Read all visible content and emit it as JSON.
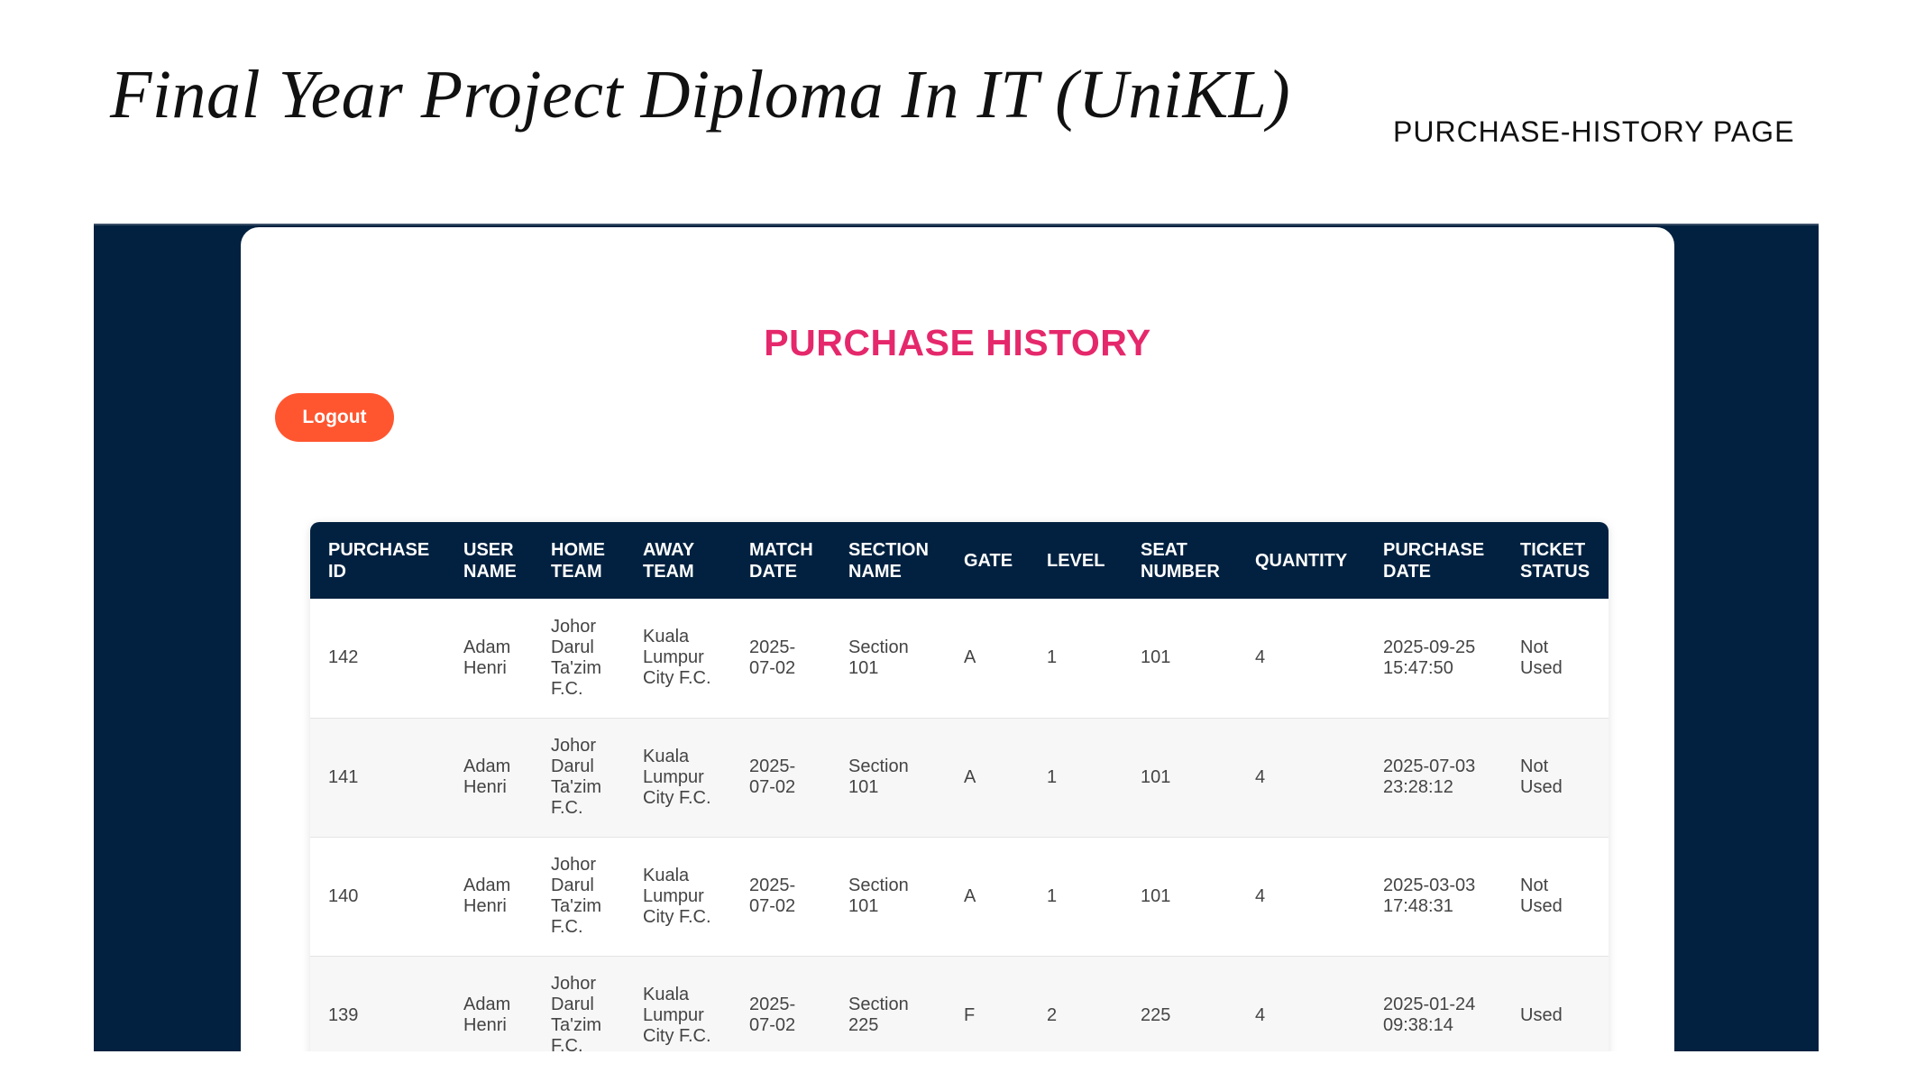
{
  "slide": {
    "title": "Final Year Project Diploma In IT (UniKL)",
    "subtitle": "PURCHASE-HISTORY PAGE"
  },
  "app": {
    "heading": "PURCHASE HISTORY",
    "logout_label": "Logout",
    "colors": {
      "frame_background": "#022140",
      "heading": "#e5286b",
      "logout_button": "#ff5630",
      "table_header": "#022140"
    }
  },
  "table": {
    "columns": [
      {
        "line1": "PURCHASE",
        "line2": "ID"
      },
      {
        "line1": "USER",
        "line2": "NAME"
      },
      {
        "line1": "HOME",
        "line2": "TEAM"
      },
      {
        "line1": "AWAY",
        "line2": "TEAM"
      },
      {
        "line1": "MATCH",
        "line2": "DATE"
      },
      {
        "line1": "SECTION",
        "line2": "NAME"
      },
      {
        "line1": "GATE",
        "line2": ""
      },
      {
        "line1": "LEVEL",
        "line2": ""
      },
      {
        "line1": "SEAT",
        "line2": "NUMBER"
      },
      {
        "line1": "QUANTITY",
        "line2": ""
      },
      {
        "line1": "PURCHASE",
        "line2": "DATE"
      },
      {
        "line1": "TICKET",
        "line2": "STATUS"
      }
    ],
    "rows": [
      {
        "purchase_id": "142",
        "user_name": [
          "Adam",
          "Henri"
        ],
        "home_team": [
          "Johor",
          "Darul",
          "Ta'zim",
          "F.C."
        ],
        "away_team": [
          "Kuala",
          "Lumpur",
          "City F.C."
        ],
        "match_date": [
          "2025-",
          "07-02"
        ],
        "section_name": [
          "Section",
          "101"
        ],
        "gate": "A",
        "level": "1",
        "seat_number": "101",
        "quantity": "4",
        "purchase_date": [
          "2025-09-25",
          "15:47:50"
        ],
        "ticket_status": [
          "Not",
          "Used"
        ]
      },
      {
        "purchase_id": "141",
        "user_name": [
          "Adam",
          "Henri"
        ],
        "home_team": [
          "Johor",
          "Darul",
          "Ta'zim",
          "F.C."
        ],
        "away_team": [
          "Kuala",
          "Lumpur",
          "City F.C."
        ],
        "match_date": [
          "2025-",
          "07-02"
        ],
        "section_name": [
          "Section",
          "101"
        ],
        "gate": "A",
        "level": "1",
        "seat_number": "101",
        "quantity": "4",
        "purchase_date": [
          "2025-07-03",
          "23:28:12"
        ],
        "ticket_status": [
          "Not",
          "Used"
        ]
      },
      {
        "purchase_id": "140",
        "user_name": [
          "Adam",
          "Henri"
        ],
        "home_team": [
          "Johor",
          "Darul",
          "Ta'zim",
          "F.C."
        ],
        "away_team": [
          "Kuala",
          "Lumpur",
          "City F.C."
        ],
        "match_date": [
          "2025-",
          "07-02"
        ],
        "section_name": [
          "Section",
          "101"
        ],
        "gate": "A",
        "level": "1",
        "seat_number": "101",
        "quantity": "4",
        "purchase_date": [
          "2025-03-03",
          "17:48:31"
        ],
        "ticket_status": [
          "Not",
          "Used"
        ]
      },
      {
        "purchase_id": "139",
        "user_name": [
          "Adam",
          "Henri"
        ],
        "home_team": [
          "Johor",
          "Darul",
          "Ta'zim",
          "F.C."
        ],
        "away_team": [
          "Kuala",
          "Lumpur",
          "City F.C."
        ],
        "match_date": [
          "2025-",
          "07-02"
        ],
        "section_name": [
          "Section",
          "225"
        ],
        "gate": "F",
        "level": "2",
        "seat_number": "225",
        "quantity": "4",
        "purchase_date": [
          "2025-01-24",
          "09:38:14"
        ],
        "ticket_status": [
          "Used"
        ]
      }
    ]
  }
}
